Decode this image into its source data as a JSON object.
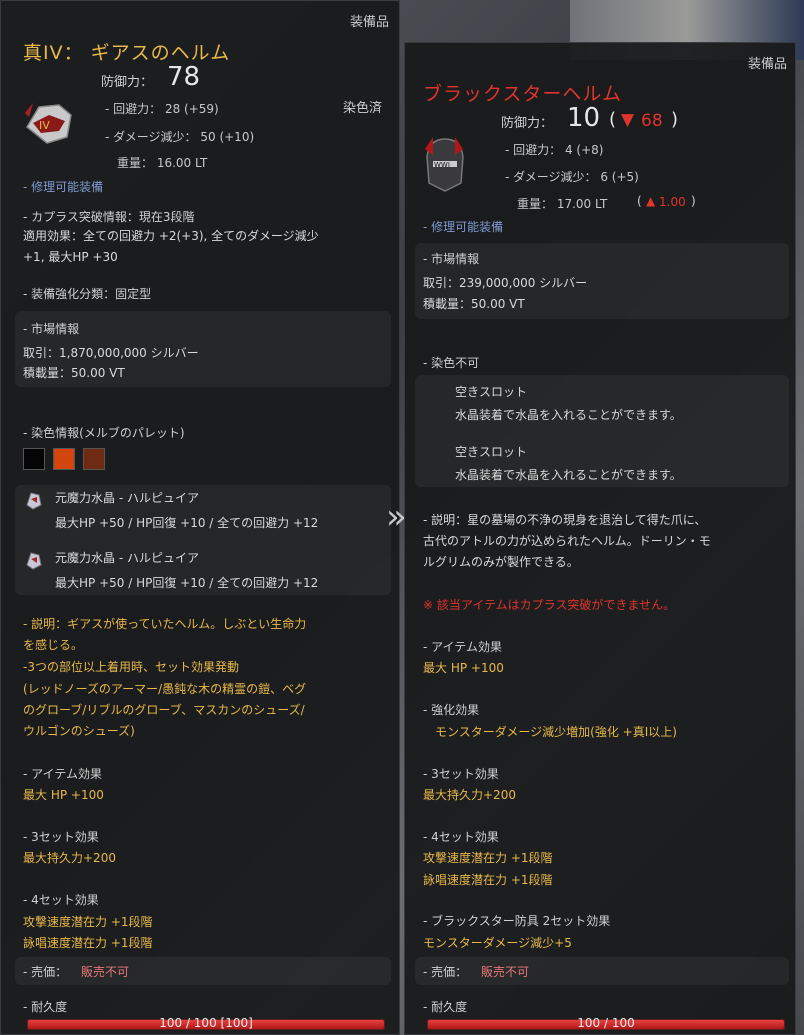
{
  "left": {
    "tag": "装備品",
    "title": "真IV： ギアスのヘルム",
    "defense_label": "防御力：",
    "defense_value": "78",
    "dyed": "染色済",
    "evasion": "- 回避力：  28 (+59)",
    "dmg_reduction": "- ダメージ減少：  50 (+10)",
    "weight": "重量：  16.00 LT",
    "repairable": "- 修理可能装備",
    "caphras_title": "- カプラス突破情報：現在3段階",
    "caphras_effect1": "適用効果：全ての回避力 +2(+3), 全てのダメージ減少",
    "caphras_effect2": "+1, 最大HP +30",
    "enhance_type": "- 装備強化分類：固定型",
    "market_title": "- 市場情報",
    "market_price": "取引：1,870,000,000 シルバー",
    "market_weight": "積載量：50.00 VT",
    "dye_info": "- 染色情報(メルブのパレット)",
    "dye_colors": [
      "#050505",
      "#d2450e",
      "#6e2a12"
    ],
    "crystals": [
      {
        "name": "元魔力水晶 - ハルピュイア",
        "effect": "最大HP +50 / HP回復 +10 / 全ての回避力 +12"
      },
      {
        "name": "元魔力水晶 - ハルピュイア",
        "effect": "最大HP +50 / HP回復 +10 / 全ての回避力 +12"
      }
    ],
    "desc1": "- 説明：ギアスが使っていたヘルム。しぶとい生命力",
    "desc2": "を感じる。",
    "set1": "-3つの部位以上着用時、セット効果発動",
    "set2": "(レッドノーズのアーマー/愚鈍な木の精霊の鎧、ベグ",
    "set3": "のグローブ/リブルのグローブ、マスカンのシューズ/",
    "set4": "ウルゴンのシューズ)",
    "item_effect_title": "- アイテム効果",
    "item_effect": "最大 HP +100",
    "set3_title": "- 3セット効果",
    "set3_effect": "最大持久力+200",
    "set4_title": "- 4セット効果",
    "set4_effect1": "攻撃速度潜在力 +1段階",
    "set4_effect2": "詠唱速度潜在力 +1段階",
    "sell_label": "- 売価：",
    "sell_value": "販売不可",
    "durability_label": "- 耐久度",
    "durability_text": "100 / 100 [100]",
    "durability_fraction": 1.0
  },
  "right": {
    "tag": "装備品",
    "title": "ブラックスターヘルム",
    "defense_label": "防御力：",
    "defense_value": "10",
    "defense_diff": "68",
    "evasion": "- 回避力：  4 (+8)",
    "dmg_reduction": "- ダメージ減少：  6 (+5)",
    "weight": "重量：  17.00 LT",
    "weight_diff": "1.00",
    "repairable": "- 修理可能装備",
    "market_title": "- 市場情報",
    "market_price": "取引：239,000,000 シルバー",
    "market_weight": "積載量：50.00 VT",
    "dye": "- 染色不可",
    "slot_label": "空きスロット",
    "slot_desc": "水晶装着で水晶を入れることができます。",
    "desc1": "- 説明：星の墓場の不浄の現身を退治して得た爪に、",
    "desc2": "古代のアトルの力が込められたヘルム。ドーリン・モ",
    "desc3": "ルグリムのみが製作できる。",
    "warning": "※ 該当アイテムはカプラス突破ができません。",
    "item_effect_title": "- アイテム効果",
    "item_effect": "最大 HP +100",
    "enhance_title": "- 強化効果",
    "enhance_effect": "モンスターダメージ減少増加(強化 +真I以上)",
    "set3_title": "- 3セット効果",
    "set3_effect": "最大持久力+200",
    "set4_title": "- 4セット効果",
    "set4_effect1": "攻撃速度潜在力 +1段階",
    "set4_effect2": "詠唱速度潜在力 +1段階",
    "bs_set_title": "- ブラックスター防具 2セット効果",
    "bs_set_effect": "モンスターダメージ減少+5",
    "sell_label": "- 売価：",
    "sell_value": "販売不可",
    "durability_label": "- 耐久度",
    "durability_text": "100 / 100",
    "durability_fraction": 1.0
  }
}
